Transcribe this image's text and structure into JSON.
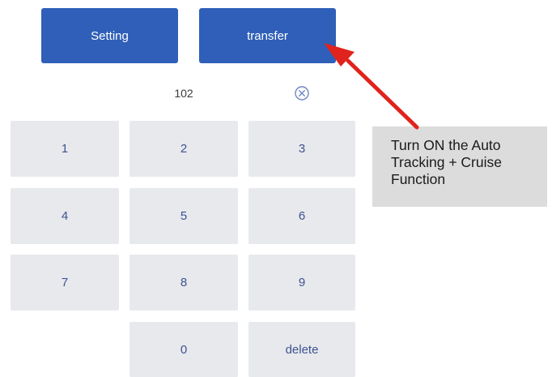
{
  "colors": {
    "primary": "#2f5fb8",
    "key_bg": "#e7e9ed",
    "key_text": "#3f5290",
    "arrow": "#e0231c",
    "callout_bg": "#dcdcdc"
  },
  "buttons": {
    "setting": "Setting",
    "transfer": "transfer"
  },
  "display": {
    "value": "102",
    "clear_icon": "circle-x-icon"
  },
  "keypad": {
    "keys": [
      "1",
      "2",
      "3",
      "4",
      "5",
      "6",
      "7",
      "8",
      "9",
      "0",
      "delete"
    ]
  },
  "callout": {
    "lines": [
      "Turn ON the Auto",
      "Tracking + Cruise",
      "Function"
    ],
    "arrow_icon": "red-arrow-icon"
  }
}
